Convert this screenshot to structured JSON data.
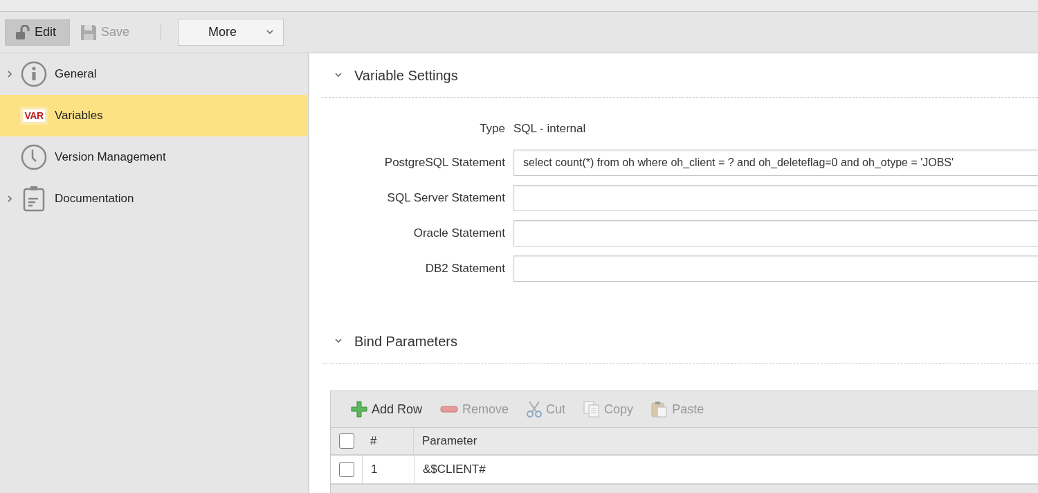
{
  "toolbar": {
    "buttons": [
      {
        "label": "Edit",
        "pressed": true,
        "disabled": false
      },
      {
        "label": "Save",
        "pressed": false,
        "disabled": true
      }
    ],
    "dropdown": {
      "label": "More"
    }
  },
  "sidebar": {
    "items": [
      {
        "label": "General",
        "expandable": true,
        "selected": false
      },
      {
        "label": "Variables",
        "icon_text": "VAR",
        "expandable": false,
        "selected": true
      },
      {
        "label": "Version Management",
        "expandable": false,
        "selected": false
      },
      {
        "label": "Documentation",
        "expandable": true,
        "selected": false
      }
    ]
  },
  "sections": [
    {
      "kind": "form",
      "title": "Variable Settings",
      "expanded": true,
      "type": {
        "label": "Type",
        "value": "SQL - internal"
      },
      "fields": [
        {
          "label": "PostgreSQL Statement",
          "value": "select count(*) from oh where oh_client = ? and oh_deleteflag=0 and oh_otype = 'JOBS'"
        },
        {
          "label": "SQL Server Statement"
        },
        {
          "label": "Oracle Statement"
        },
        {
          "label": "DB2 Statement"
        }
      ]
    },
    {
      "kind": "grid",
      "title": "Bind Parameters",
      "expanded": true,
      "grid_toolbar": [
        {
          "label": "Add Row",
          "disabled": false
        },
        {
          "label": "Remove",
          "disabled": true
        },
        {
          "label": "Cut",
          "disabled": true
        },
        {
          "label": "Copy",
          "disabled": true
        },
        {
          "label": "Paste",
          "disabled": true
        }
      ],
      "header_checked": false,
      "columns": [
        "#",
        "Parameter"
      ],
      "rows": [
        {
          "checked": false,
          "number": "1",
          "parameter": "&$CLIENT#"
        }
      ]
    }
  ]
}
